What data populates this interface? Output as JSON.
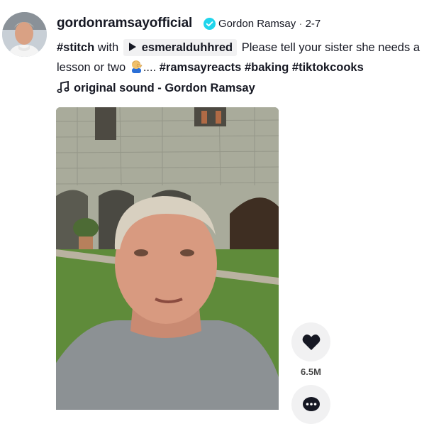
{
  "post": {
    "username": "gordonramsayofficial",
    "nickname": "Gordon Ramsay",
    "separator": "·",
    "date": "2-7",
    "caption": {
      "stitch_tag": "#stitch",
      "with_text": "with",
      "stitch_user": "esmeralduhhred",
      "text": "Please tell your sister she needs a lesson or two",
      "emoji": "man-facepalming-emoji",
      "ellipsis": "....",
      "hashtags": [
        "#ramsayreacts",
        "#baking",
        "#tiktokcooks"
      ]
    },
    "sound": "original sound - Gordon Ramsay"
  },
  "actions": {
    "like_count": "6.5M"
  },
  "colors": {
    "text": "#161823",
    "verified": "#20d5ec",
    "action_bg": "#f1f1f2"
  },
  "icons": [
    "verified-badge-icon",
    "play-icon",
    "music-note-icon",
    "heart-icon",
    "comment-icon"
  ]
}
